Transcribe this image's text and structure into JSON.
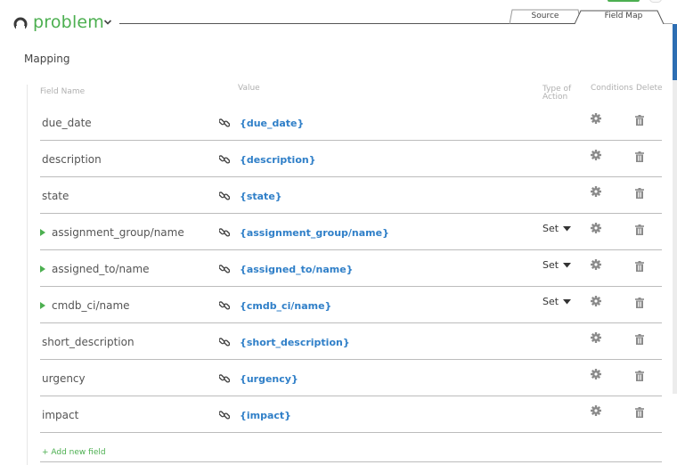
{
  "header": {
    "title": "problem",
    "tabs": [
      {
        "label": "Source",
        "active": false
      },
      {
        "label": "Field Map",
        "active": true
      }
    ]
  },
  "section": {
    "title": "Mapping"
  },
  "columns": {
    "field_name": "Field Name",
    "value": "Value",
    "type_of_action": "Type of Action",
    "conditions": "Conditions",
    "delete": "Delete"
  },
  "rows": [
    {
      "name": "due_date",
      "value": "{due_date}",
      "expandable": false,
      "action": ""
    },
    {
      "name": "description",
      "value": "{description}",
      "expandable": false,
      "action": ""
    },
    {
      "name": "state",
      "value": "{state}",
      "expandable": false,
      "action": ""
    },
    {
      "name": "assignment_group/name",
      "value": "{assignment_group/name}",
      "expandable": true,
      "action": "Set"
    },
    {
      "name": "assigned_to/name",
      "value": "{assigned_to/name}",
      "expandable": true,
      "action": "Set"
    },
    {
      "name": "cmdb_ci/name",
      "value": "{cmdb_ci/name}",
      "expandable": true,
      "action": "Set"
    },
    {
      "name": "short_description",
      "value": "{short_description}",
      "expandable": false,
      "action": ""
    },
    {
      "name": "urgency",
      "value": "{urgency}",
      "expandable": false,
      "action": ""
    },
    {
      "name": "impact",
      "value": "{impact}",
      "expandable": false,
      "action": ""
    }
  ],
  "add_field_label": "+ Add new field",
  "colors": {
    "accent_green": "#4caf50",
    "value_blue": "#2f7fc8",
    "scroll_blue": "#2d6eb3",
    "icon_gray": "#8a8a8a"
  },
  "icons": {
    "app": "circle-logo-icon",
    "title_menu": "chevron-down-icon",
    "link": "link-icon",
    "conditions": "gear-icon",
    "delete": "trash-icon",
    "expand": "caret-right-icon",
    "action_menu": "caret-down-icon"
  }
}
